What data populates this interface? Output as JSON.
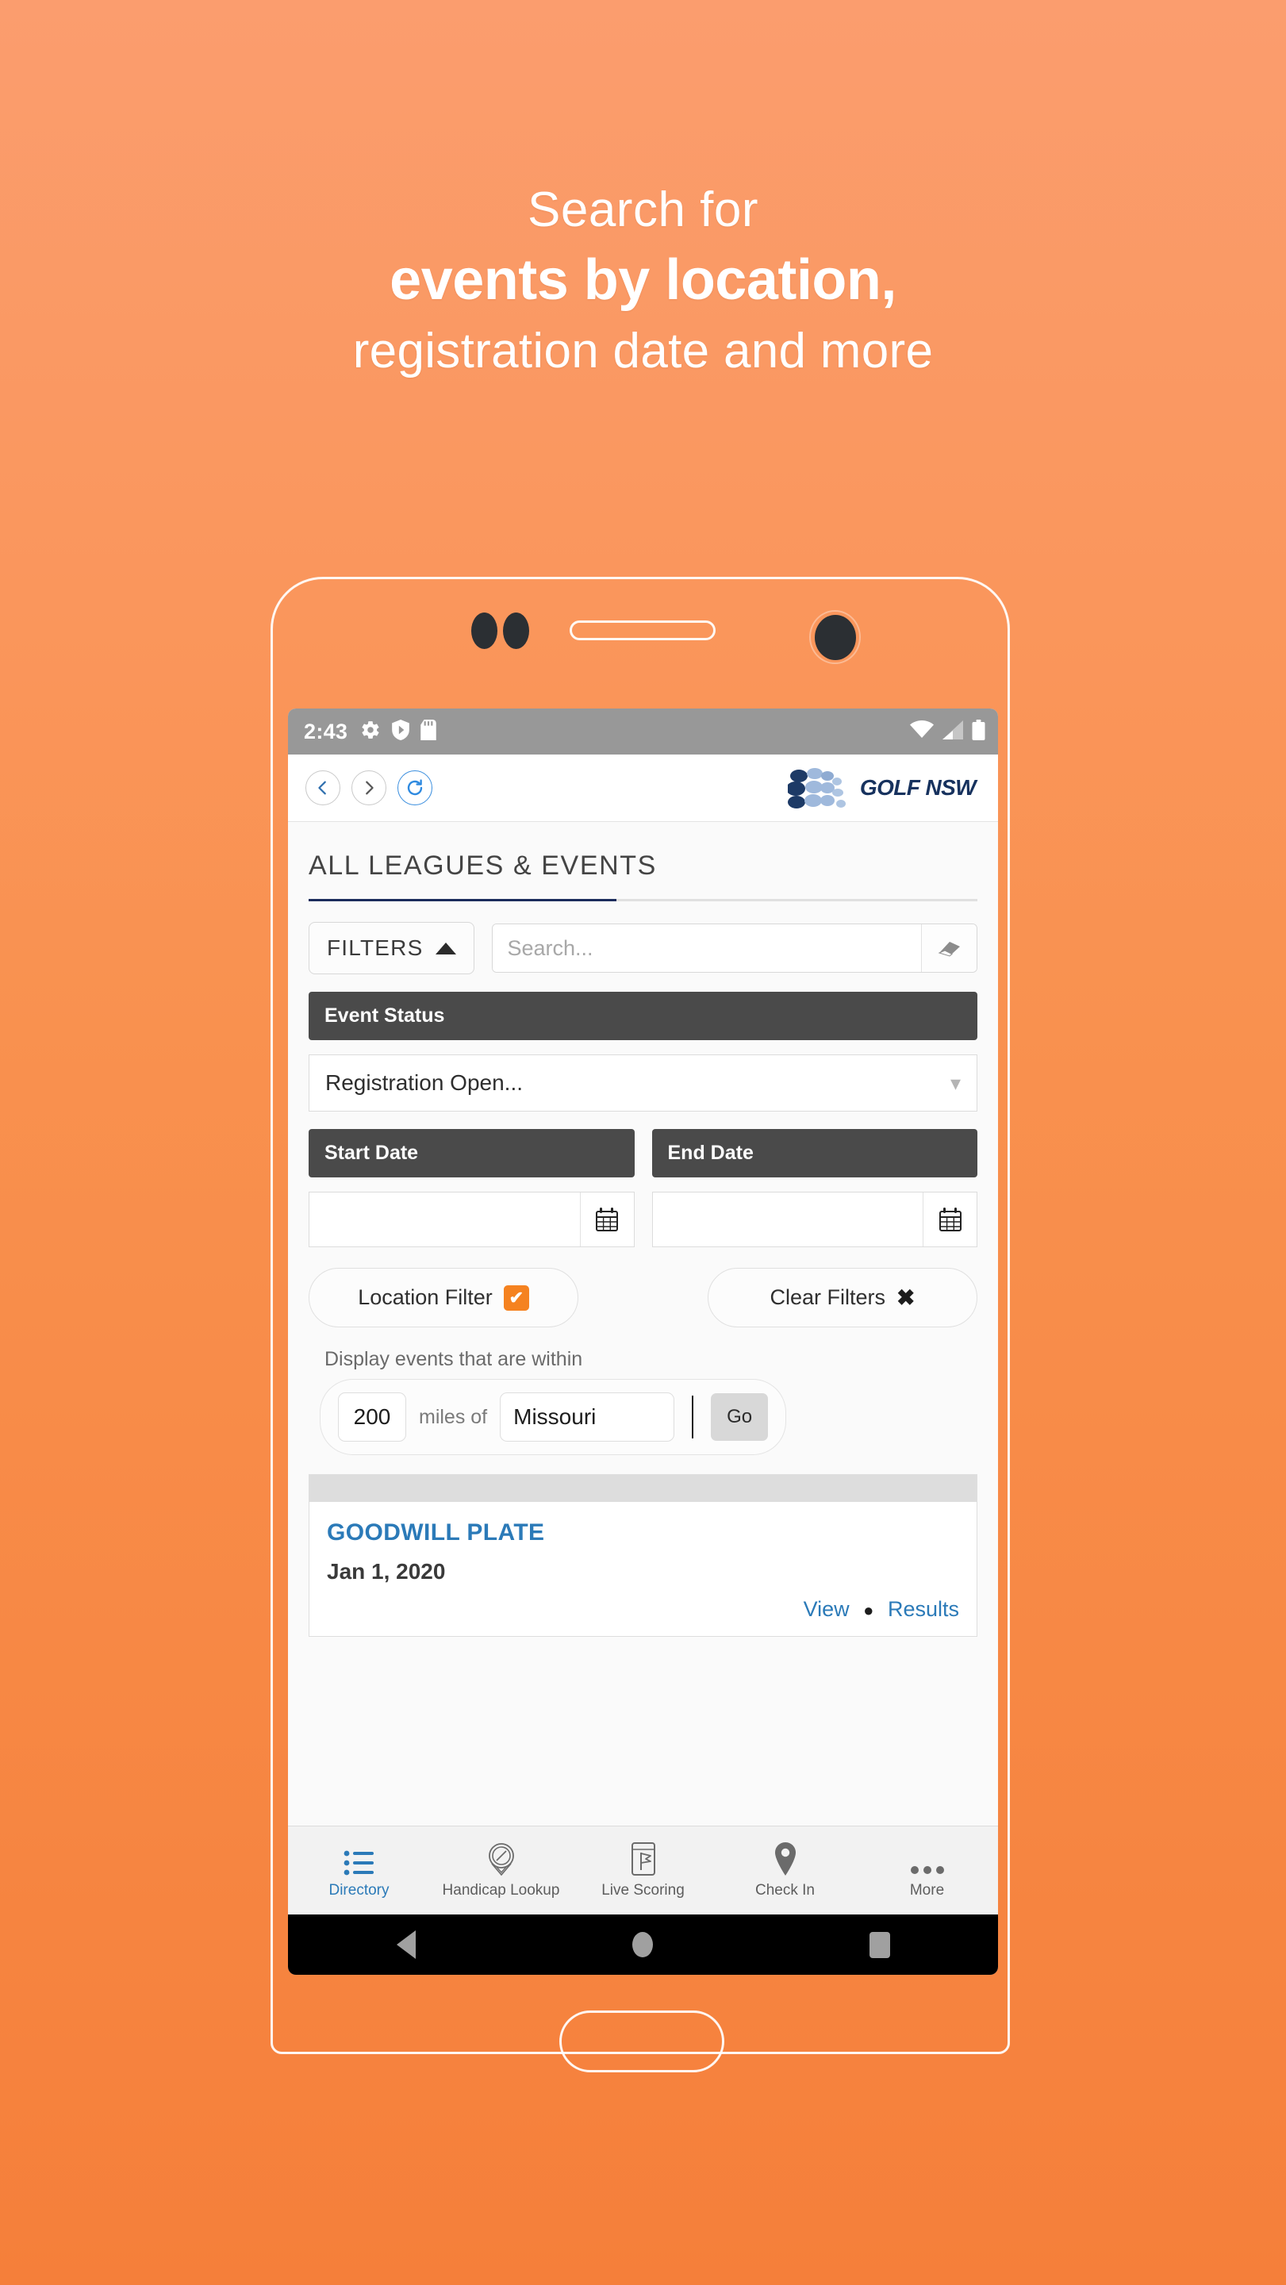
{
  "marketing": {
    "line1": "Search for",
    "line2": "events by location,",
    "line3": "registration date and more",
    "background_top": "#fb9d6e",
    "background_bottom": "#f57f3a"
  },
  "statusbar": {
    "time": "2:43",
    "left_icons": [
      "gear-icon",
      "shield-icon",
      "sdcard-icon"
    ],
    "right_icons": [
      "wifi-icon",
      "signal-icon",
      "battery-icon"
    ],
    "background": "#989898"
  },
  "browser_header": {
    "back_label": "Back",
    "forward_label": "Forward",
    "refresh_label": "Refresh",
    "logo_text": "GOLF NSW",
    "logo_color": "#17325e"
  },
  "page": {
    "title": "ALL LEAGUES & EVENTS",
    "accent_color": "#1b2c5c"
  },
  "filters": {
    "button_label": "FILTERS",
    "search_placeholder": "Search...",
    "search_value": "",
    "erase_label": "Erase",
    "event_status_label": "Event Status",
    "event_status_value": "Registration Open...",
    "start_date_label": "Start Date",
    "start_date_value": "",
    "end_date_label": "End Date",
    "end_date_value": "",
    "location_filter_label": "Location Filter",
    "location_filter_checked": "✔",
    "clear_filters_label": "Clear Filters",
    "clear_filters_mark": "✖",
    "accent_color": "#f58220"
  },
  "location": {
    "within_label": "Display events that are within",
    "distance_value": "200",
    "distance_unit": "miles of",
    "place_value": "Missouri",
    "go_label": "Go"
  },
  "events": [
    {
      "name": "GOODWILL PLATE",
      "date": "Jan 1, 2020",
      "view_label": "View",
      "separator": "●",
      "results_label": "Results"
    }
  ],
  "tabbar": {
    "items": [
      {
        "label": "Directory",
        "icon": "list-icon",
        "active": true
      },
      {
        "label": "Handicap Lookup",
        "icon": "compass-pin-icon",
        "active": false
      },
      {
        "label": "Live Scoring",
        "icon": "scorecard-flag-icon",
        "active": false
      },
      {
        "label": "Check In",
        "icon": "map-pin-icon",
        "active": false
      },
      {
        "label": "More",
        "icon": "ellipsis-icon",
        "active": false
      }
    ],
    "active_color": "#2b7ab8",
    "inactive_color": "#5d5d5d"
  },
  "android_nav": {
    "back_label": "Back",
    "home_label": "Home",
    "recents_label": "Recents"
  }
}
